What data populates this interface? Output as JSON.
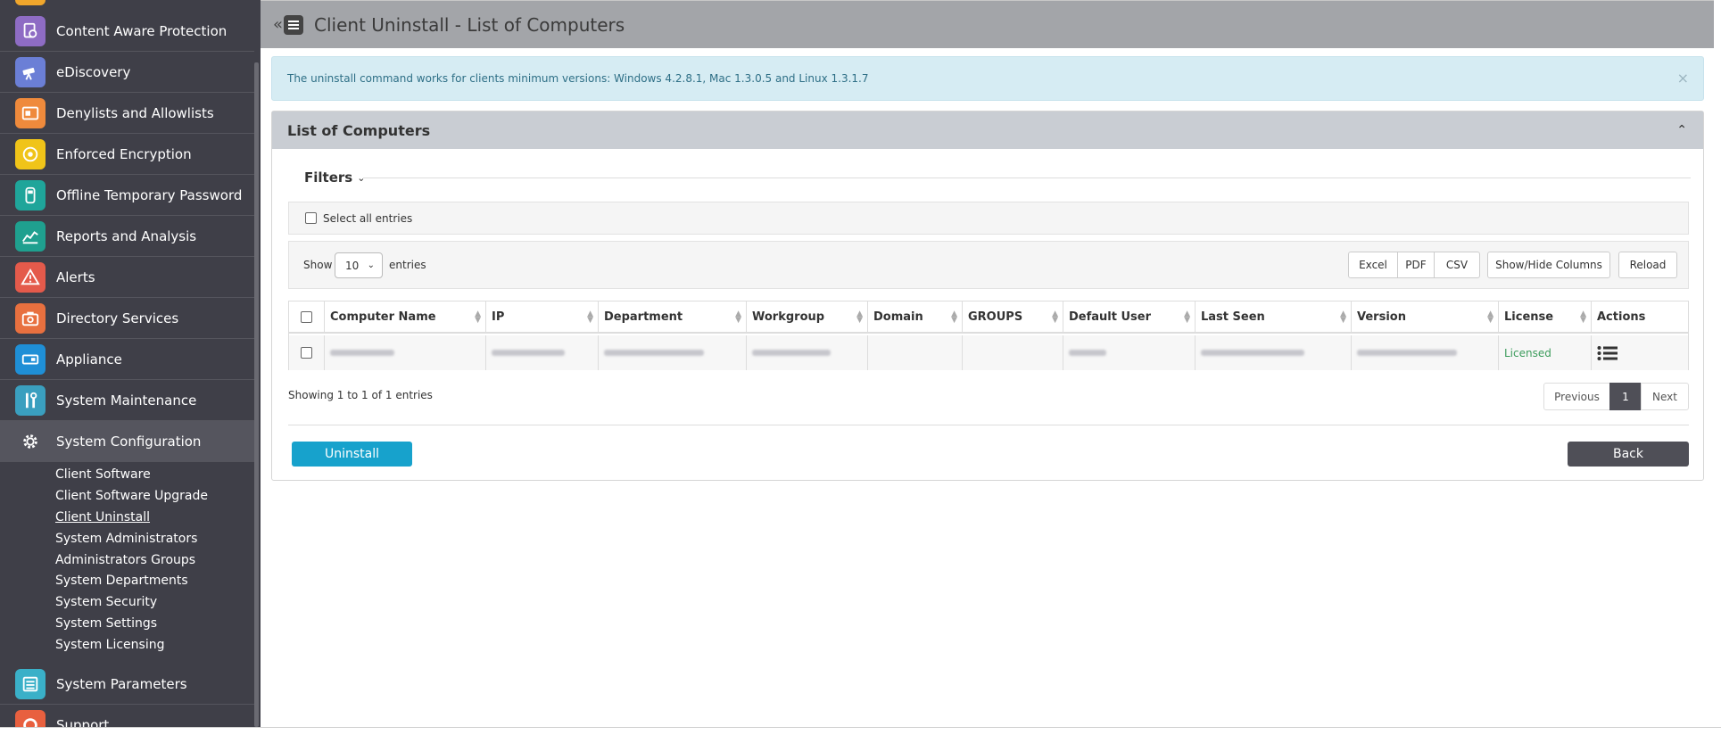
{
  "sidebar": {
    "items": [
      {
        "label": "Content Aware Protection",
        "icon": "shield-doc-icon",
        "color": "#8e6cc4"
      },
      {
        "label": "eDiscovery",
        "icon": "telescope-icon",
        "color": "#6b7fd6"
      },
      {
        "label": "Denylists and Allowlists",
        "icon": "list-card-icon",
        "color": "#ef8a3c"
      },
      {
        "label": "Enforced Encryption",
        "icon": "disc-icon",
        "color": "#f0c419"
      },
      {
        "label": "Offline Temporary Password",
        "icon": "usb-icon",
        "color": "#1fa59a"
      },
      {
        "label": "Reports and Analysis",
        "icon": "chart-icon",
        "color": "#1fa08f"
      },
      {
        "label": "Alerts",
        "icon": "warning-icon",
        "color": "#e45a4b"
      },
      {
        "label": "Directory Services",
        "icon": "directory-icon",
        "color": "#e8703f"
      },
      {
        "label": "Appliance",
        "icon": "server-icon",
        "color": "#1f8fd6"
      },
      {
        "label": "System Maintenance",
        "icon": "tools-icon",
        "color": "#3a9fbf"
      },
      {
        "label": "System Configuration",
        "icon": "gear-icon",
        "color": "#56565e"
      },
      {
        "label": "System Parameters",
        "icon": "parameters-icon",
        "color": "#3ab0c8"
      },
      {
        "label": "Support",
        "icon": "support-icon",
        "color": "#e8603f"
      }
    ],
    "sub_items": [
      "Client Software",
      "Client Software Upgrade",
      "Client Uninstall",
      "System Administrators",
      "Administrators Groups",
      "System Departments",
      "System Security",
      "System Settings",
      "System Licensing"
    ]
  },
  "header": {
    "toggle_chevron": "«",
    "title": "Client Uninstall - List of Computers"
  },
  "alert": {
    "text": "The uninstall command works for clients minimum versions: Windows 4.2.8.1, Mac 1.3.0.5 and Linux 1.3.1.7",
    "close": "×"
  },
  "panel": {
    "title": "List of Computers",
    "collapse": "⌃",
    "filters_label": "Filters",
    "filters_chevron": "⌄",
    "select_all_label": "Select all entries",
    "show_label": "Show",
    "page_size": "10",
    "page_size_arrow": "⌄",
    "entries_label": "entries",
    "buttons": {
      "excel": "Excel",
      "pdf": "PDF",
      "csv": "CSV",
      "show_hide": "Show/Hide Columns",
      "reload": "Reload"
    }
  },
  "table": {
    "columns": [
      "Computer Name",
      "IP",
      "Department",
      "Workgroup",
      "Domain",
      "GROUPS",
      "Default User",
      "Last Seen",
      "Version",
      "License",
      "Actions"
    ],
    "rows": [
      {
        "license": "Licensed"
      }
    ]
  },
  "footer": {
    "showing": "Showing 1 to 1 of 1 entries",
    "previous": "Previous",
    "page": "1",
    "next": "Next",
    "uninstall": "Uninstall",
    "back": "Back"
  }
}
